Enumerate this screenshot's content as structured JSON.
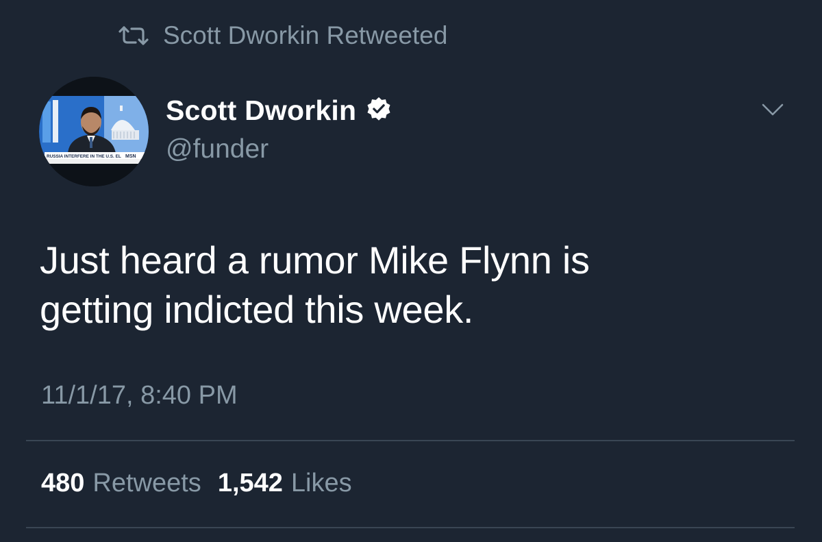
{
  "retweet_context": {
    "icon": "retweet-icon",
    "text": "Scott Dworkin Retweeted"
  },
  "author": {
    "display_name": "Scott Dworkin",
    "verified_icon": "verified-badge-icon",
    "handle": "@funder",
    "avatar_ticker": "RUSSIA INTERFERE IN THE U.S. ELECTION?",
    "avatar_network": "MSN"
  },
  "menu_icon": "chevron-down-icon",
  "tweet": {
    "line1": "Just heard a rumor Mike Flynn is",
    "line2": "getting indicted this week.",
    "timestamp": "11/1/17, 8:40 PM"
  },
  "stats": {
    "retweets_count": "480",
    "retweets_label": "Retweets",
    "likes_count": "1,542",
    "likes_label": "Likes"
  },
  "colors": {
    "background": "#1c2532",
    "primary_text": "#ffffff",
    "secondary_text": "#8899a6",
    "divider": "#3a4654"
  }
}
